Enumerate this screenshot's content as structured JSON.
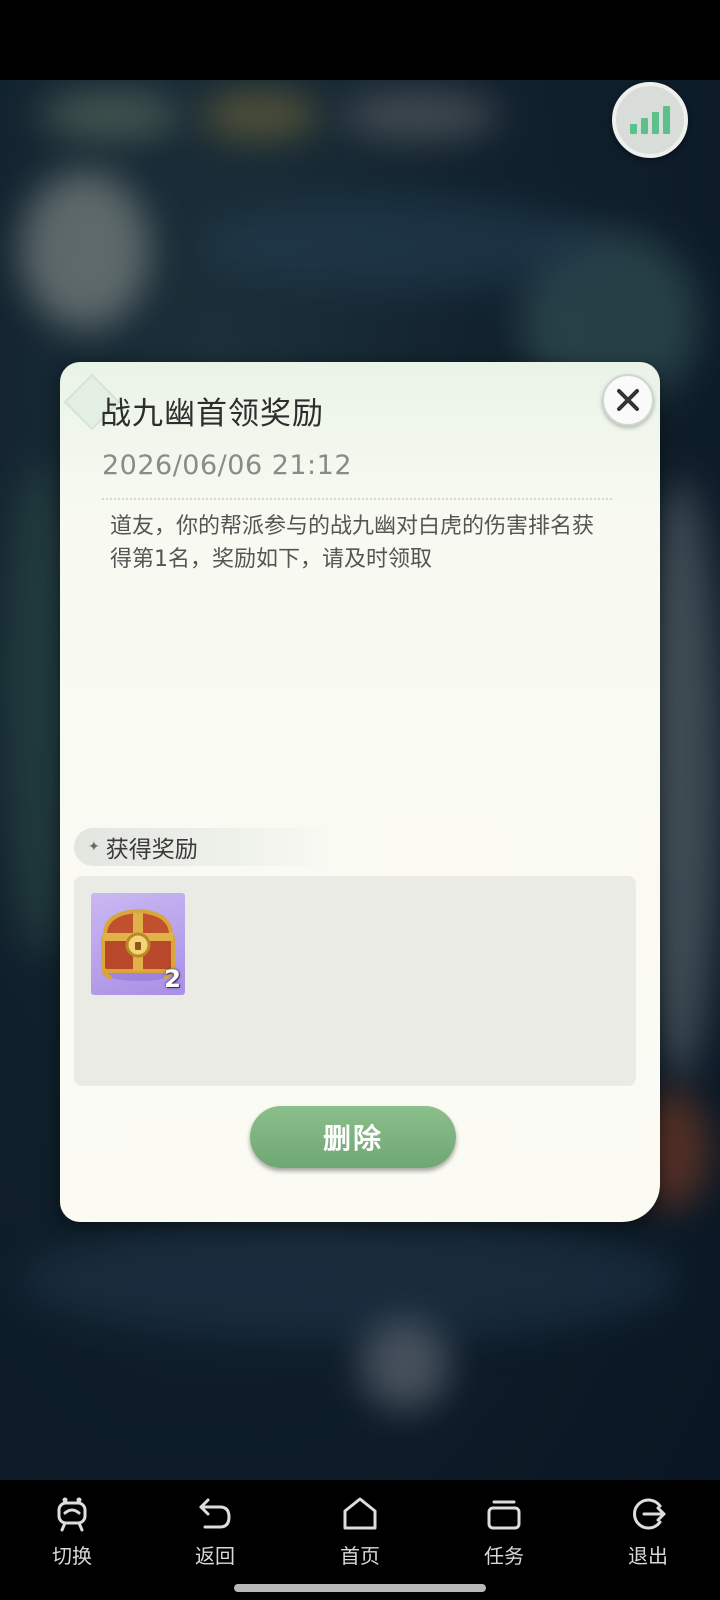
{
  "dialog": {
    "title": "战九幽首领奖励",
    "date": "2026/06/06 21:12",
    "message": "道友，你的帮派参与的战九幽对白虎的伤害排名获得第1名，奖励如下，请及时领取",
    "reward_section_title": "获得奖励",
    "rewards": [
      {
        "icon": "treasure-chest-icon",
        "count": "2"
      }
    ],
    "delete_label": "删除",
    "close_icon": "close-icon"
  },
  "hud": {
    "signal_icon": "signal-bars-icon"
  },
  "nav": {
    "items": [
      {
        "label": "切换",
        "icon": "switch-icon"
      },
      {
        "label": "返回",
        "icon": "back-icon"
      },
      {
        "label": "首页",
        "icon": "home-icon"
      },
      {
        "label": "任务",
        "icon": "tasks-icon"
      },
      {
        "label": "退出",
        "icon": "exit-icon"
      }
    ]
  },
  "colors": {
    "accent_green": "#6fa774",
    "dialog_bg": "#fbfbf4",
    "reward_item_bg": "#b39ceb"
  }
}
